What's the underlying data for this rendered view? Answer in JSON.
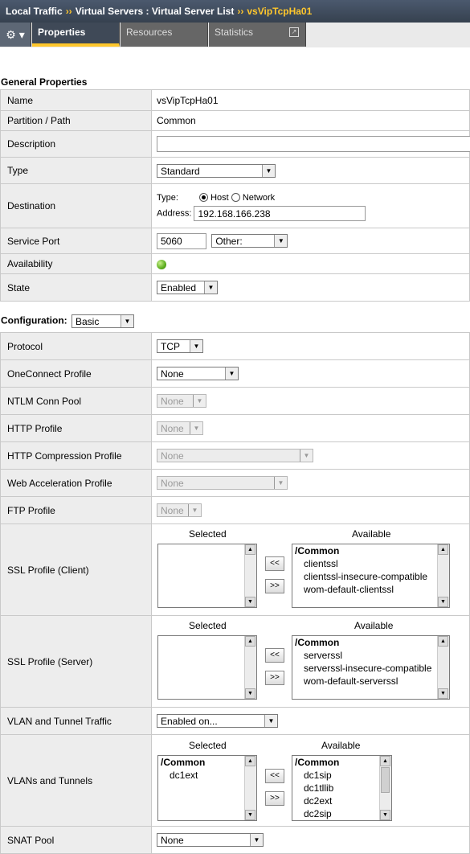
{
  "breadcrumb": {
    "part1": "Local Traffic",
    "sep1": "››",
    "part2": "Virtual Servers : Virtual Server List",
    "sep2": "››",
    "current": "vsVipTcpHa01"
  },
  "tabs": {
    "gear": "⚙ ▾",
    "properties": "Properties",
    "resources": "Resources",
    "statistics": "Statistics"
  },
  "general": {
    "title": "General Properties",
    "name_label": "Name",
    "name_value": "vsVipTcpHa01",
    "partition_label": "Partition / Path",
    "partition_value": "Common",
    "description_label": "Description",
    "description_value": "",
    "type_label": "Type",
    "type_value": "Standard",
    "destination_label": "Destination",
    "dest_type_label": "Type:",
    "dest_host": "Host",
    "dest_network": "Network",
    "dest_address_label": "Address:",
    "dest_address_value": "192.168.166.238",
    "port_label": "Service Port",
    "port_value": "5060",
    "port_select": "Other:",
    "availability_label": "Availability",
    "availability_status": "available",
    "availability_color": "#5cae1e",
    "state_label": "State",
    "state_value": "Enabled"
  },
  "config": {
    "title": "Configuration:",
    "mode": "Basic",
    "protocol_label": "Protocol",
    "protocol_value": "TCP",
    "oneconnect_label": "OneConnect Profile",
    "oneconnect_value": "None",
    "ntlm_label": "NTLM Conn Pool",
    "ntlm_value": "None",
    "http_label": "HTTP Profile",
    "http_value": "None",
    "httpcomp_label": "HTTP Compression Profile",
    "httpcomp_value": "None",
    "webacc_label": "Web Acceleration Profile",
    "webacc_value": "None",
    "ftp_label": "FTP Profile",
    "ftp_value": "None",
    "selected_hdr": "Selected",
    "available_hdr": "Available",
    "move_left": "<<",
    "move_right": ">>",
    "ssl_client_label": "SSL Profile (Client)",
    "ssl_client_available": [
      "/Common",
      "clientssl",
      "clientssl-insecure-compatible",
      "wom-default-clientssl"
    ],
    "ssl_server_label": "SSL Profile (Server)",
    "ssl_server_available": [
      "/Common",
      "serverssl",
      "serverssl-insecure-compatible",
      "wom-default-serverssl"
    ],
    "vlan_traffic_label": "VLAN and Tunnel Traffic",
    "vlan_traffic_value": "Enabled on...",
    "vlans_label": "VLANs and Tunnels",
    "vlans_selected": [
      "/Common",
      "dc1ext"
    ],
    "vlans_available": [
      "/Common",
      "dc1sip",
      "dc1tllib",
      "dc2ext",
      "dc2sip"
    ],
    "snat_label": "SNAT Pool",
    "snat_value": "None"
  },
  "colors": {
    "accent": "#ffc72c",
    "header_bg": "#3f4957",
    "label_bg": "#ededed"
  }
}
